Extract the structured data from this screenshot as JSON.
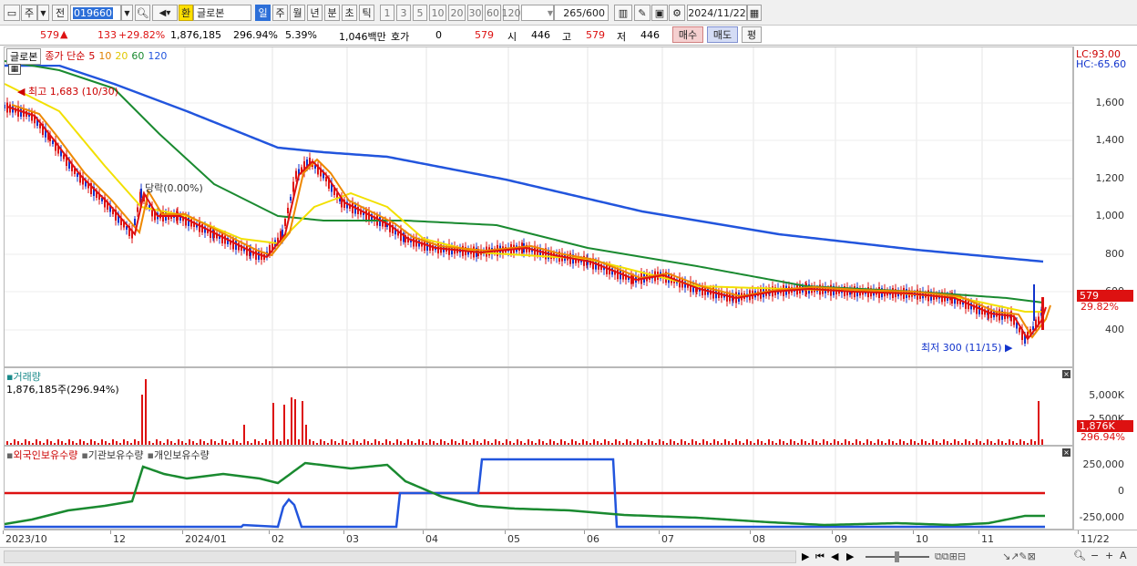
{
  "toolbar": {
    "period_unit": "주",
    "prev_label": "전",
    "stock_code": "019660",
    "currency_label": "환",
    "stock_name": "글로본",
    "period_tabs": [
      "일",
      "주",
      "월",
      "년",
      "분",
      "초",
      "틱"
    ],
    "interval_buttons": [
      "1",
      "3",
      "5",
      "10",
      "20",
      "30",
      "60",
      "120"
    ],
    "count_value": "265",
    "count_total": "/600",
    "date": "2024/11/22"
  },
  "quote": {
    "price": "579",
    "arrow": "▲",
    "change": "133",
    "change_pct": "+29.82%",
    "volume": "1,876,185",
    "volume_pct": "296.94%",
    "turnover": "5.39%",
    "amount": "1,046백만",
    "hoga_label": "호가",
    "hoga_value": "0",
    "hoga_price": "579",
    "open_label": "시",
    "open": "446",
    "high_label": "고",
    "high": "579",
    "low_label": "저",
    "low": "446",
    "buy": "매수",
    "sell": "매도",
    "eval": "평"
  },
  "price_panel": {
    "name": "글로본",
    "legend": [
      {
        "text": "종가 단순",
        "color": "#cc0000"
      },
      {
        "text": "5",
        "color": "#cc0000"
      },
      {
        "text": "10",
        "color": "#e08000"
      },
      {
        "text": "20",
        "color": "#e0c800"
      },
      {
        "text": "60",
        "color": "#1a8a30"
      },
      {
        "text": "120",
        "color": "#2255dd"
      }
    ],
    "lc": "LC:93.00",
    "hc": "HC:-65.60",
    "y_ticks": [
      "1,600",
      "1,400",
      "1,200",
      "1,000",
      "800",
      "600",
      "400"
    ],
    "high_note": "최고 1,683 (10/30)",
    "low_note": "최저 300 (11/15)",
    "dividend_note": "당락(0.00%)",
    "price_tag": "579",
    "pct_tag": "29.82%"
  },
  "volume_panel": {
    "title": "거래량",
    "value": "1,876,185주(296.94%)",
    "y_ticks": [
      "5,000K",
      "2,500K"
    ],
    "vol_tag": "1,876K",
    "pct_tag": "296.94%"
  },
  "holding_panel": {
    "legend": [
      {
        "text": "외국인보유수량",
        "color": "#cc0000"
      },
      {
        "text": "기관보유수량",
        "color": "#2255dd"
      },
      {
        "text": "개인보유수량",
        "color": "#1a8a30"
      }
    ],
    "y_ticks": [
      "250,000",
      "0",
      "-250,000"
    ]
  },
  "x_axis": [
    "2023/10",
    "12",
    "2024/01",
    "02",
    "03",
    "04",
    "05",
    "06",
    "07",
    "08",
    "09",
    "10",
    "11",
    "11/22"
  ],
  "colors": {
    "up": "#dd1111",
    "down": "#1133cc",
    "ma5": "#dd1111",
    "ma10": "#ee8800",
    "ma20": "#f2e000",
    "ma60": "#1a8a30",
    "ma120": "#2255dd"
  }
}
